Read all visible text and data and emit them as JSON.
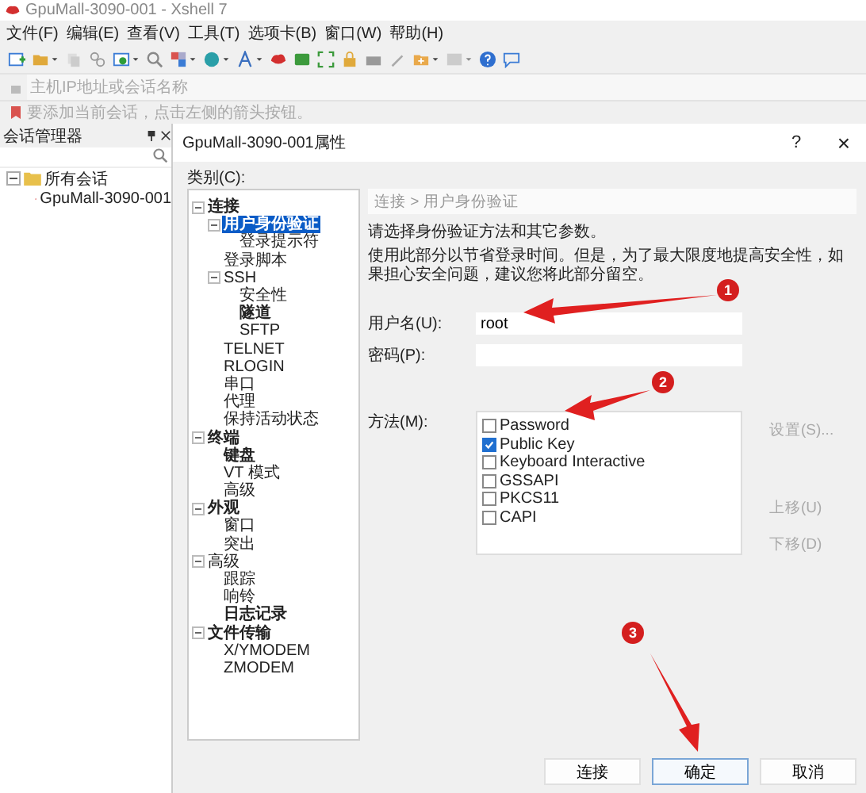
{
  "window": {
    "title": "GpuMall-3090-001 - Xshell 7"
  },
  "menu": [
    "文件(F)",
    "编辑(E)",
    "查看(V)",
    "工具(T)",
    "选项卡(B)",
    "窗口(W)",
    "帮助(H)"
  ],
  "address_bar": {
    "placeholder": "主机IP地址或会话名称"
  },
  "info_bar": {
    "text": "要添加当前会话，点击左侧的箭头按钮。"
  },
  "session_manager": {
    "title": "会话管理器",
    "tree": [
      {
        "label": "所有会话",
        "expanded": true,
        "children": [
          {
            "label": "GpuMall-3090-001"
          }
        ]
      }
    ]
  },
  "dialog": {
    "title": "GpuMall-3090-001属性",
    "help": "?",
    "close": "×",
    "category_label": "类别(C):",
    "tree": [
      {
        "label": "连接",
        "bold": true,
        "selected": false,
        "expanded": true,
        "children": [
          {
            "label": "用户身份验证",
            "bold": true,
            "selected": true,
            "expanded": true,
            "children": [
              {
                "label": "登录提示符",
                "bold": false,
                "selected": false
              }
            ]
          },
          {
            "label": "登录脚本",
            "bold": false,
            "selected": false
          },
          {
            "label": "SSH",
            "bold": false,
            "selected": false,
            "expanded": true,
            "children": [
              {
                "label": "安全性",
                "bold": false,
                "selected": false
              },
              {
                "label": "隧道",
                "bold": true,
                "selected": false
              },
              {
                "label": "SFTP",
                "bold": false,
                "selected": false
              }
            ]
          },
          {
            "label": "TELNET",
            "bold": false,
            "selected": false
          },
          {
            "label": "RLOGIN",
            "bold": false,
            "selected": false
          },
          {
            "label": "串口",
            "bold": false,
            "selected": false
          },
          {
            "label": "代理",
            "bold": false,
            "selected": false
          },
          {
            "label": "保持活动状态",
            "bold": false,
            "selected": false
          }
        ]
      },
      {
        "label": "终端",
        "bold": true,
        "selected": false,
        "expanded": true,
        "children": [
          {
            "label": "键盘",
            "bold": true,
            "selected": false
          },
          {
            "label": "VT 模式",
            "bold": false,
            "selected": false
          },
          {
            "label": "高级",
            "bold": false,
            "selected": false
          }
        ]
      },
      {
        "label": "外观",
        "bold": true,
        "selected": false,
        "expanded": true,
        "children": [
          {
            "label": "窗口",
            "bold": false,
            "selected": false
          },
          {
            "label": "突出",
            "bold": false,
            "selected": false
          }
        ]
      },
      {
        "label": "高级",
        "bold": false,
        "selected": false,
        "expanded": true,
        "children": [
          {
            "label": "跟踪",
            "bold": false,
            "selected": false
          },
          {
            "label": "响铃",
            "bold": false,
            "selected": false
          },
          {
            "label": "日志记录",
            "bold": true,
            "selected": false
          }
        ]
      },
      {
        "label": "文件传输",
        "bold": true,
        "selected": false,
        "expanded": true,
        "children": [
          {
            "label": "X/YMODEM",
            "bold": false,
            "selected": false
          },
          {
            "label": "ZMODEM",
            "bold": false,
            "selected": false
          }
        ]
      }
    ],
    "breadcrumb": "连接 > 用户身份验证",
    "intro": "请选择身份验证方法和其它参数。",
    "note": "使用此部分以节省登录时间。但是，为了最大限度地提高安全性，如果担心安全问题，建议您将此部分留空。",
    "username": {
      "label": "用户名(U):",
      "value": "root"
    },
    "password": {
      "label": "密码(P):"
    },
    "methods_label": "方法(M):",
    "methods": [
      {
        "label": "Password",
        "checked": false
      },
      {
        "label": "Public Key",
        "checked": true
      },
      {
        "label": "Keyboard Interactive",
        "checked": false
      },
      {
        "label": "GSSAPI",
        "checked": false
      },
      {
        "label": "PKCS11",
        "checked": false
      },
      {
        "label": "CAPI",
        "checked": false
      }
    ],
    "side_buttons": [
      {
        "label": "设置(S)...",
        "disabled": true
      },
      {
        "label": "上移(U)",
        "disabled": true
      },
      {
        "label": "下移(D)",
        "disabled": true
      }
    ],
    "buttons": [
      {
        "label": "连接",
        "focused": false
      },
      {
        "label": "确定",
        "focused": true
      },
      {
        "label": "取消",
        "focused": false
      }
    ]
  },
  "annotations": [
    {
      "label": "1"
    },
    {
      "label": "2"
    },
    {
      "label": "3"
    }
  ]
}
